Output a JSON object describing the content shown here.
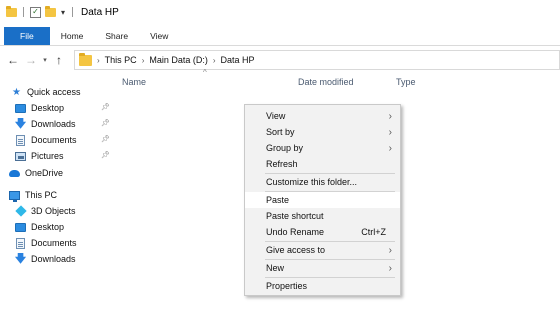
{
  "window": {
    "title": "Data HP"
  },
  "ribbon": {
    "tabs": [
      "File",
      "Home",
      "Share",
      "View"
    ]
  },
  "address": {
    "crumbs": [
      "This PC",
      "Main Data (D:)",
      "Data HP"
    ]
  },
  "columns": [
    "Name",
    "Date modified",
    "Type"
  ],
  "nav": {
    "quick_access": "Quick access",
    "quick_items": [
      "Desktop",
      "Downloads",
      "Documents",
      "Pictures"
    ],
    "onedrive": "OneDrive",
    "this_pc": "This PC",
    "pc_items": [
      "3D Objects",
      "Desktop",
      "Documents",
      "Downloads"
    ]
  },
  "menu": {
    "view": "View",
    "sort_by": "Sort by",
    "group_by": "Group by",
    "refresh": "Refresh",
    "customize": "Customize this folder...",
    "paste": "Paste",
    "paste_shortcut": "Paste shortcut",
    "undo_rename": "Undo Rename",
    "undo_rename_shortcut": "Ctrl+Z",
    "give_access": "Give access to",
    "new": "New",
    "properties": "Properties"
  }
}
